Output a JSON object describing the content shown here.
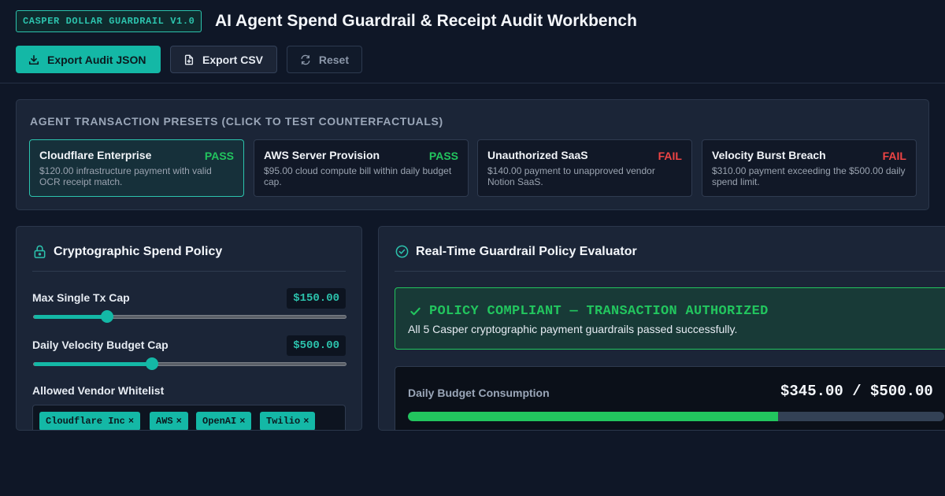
{
  "header": {
    "badge": "CASPER DOLLAR GUARDRAIL V1.0",
    "title": "AI Agent Spend Guardrail & Receipt Audit Workbench",
    "buttons": {
      "export_json": "Export Audit JSON",
      "export_csv": "Export CSV",
      "reset": "Reset"
    }
  },
  "presets": {
    "title": "AGENT TRANSACTION PRESETS (CLICK TO TEST COUNTERFACTUALS)",
    "items": [
      {
        "name": "Cloudflare Enterprise",
        "status": "PASS",
        "desc": "$120.00 infrastructure payment with valid OCR receipt match."
      },
      {
        "name": "AWS Server Provision",
        "status": "PASS",
        "desc": "$95.00 cloud compute bill within daily budget cap."
      },
      {
        "name": "Unauthorized SaaS",
        "status": "FAIL",
        "desc": "$140.00 payment to unapproved vendor Notion SaaS."
      },
      {
        "name": "Velocity Burst Breach",
        "status": "FAIL",
        "desc": "$310.00 payment exceeding the $500.00 daily spend limit."
      }
    ]
  },
  "policy": {
    "title": "Cryptographic Spend Policy",
    "max_tx": {
      "label": "Max Single Tx Cap",
      "value": "$150.00",
      "fraction": 0.235
    },
    "daily_cap": {
      "label": "Daily Velocity Budget Cap",
      "value": "$500.00",
      "fraction": 0.38
    },
    "vendors": {
      "label": "Allowed Vendor Whitelist",
      "tags": [
        "Cloudflare Inc",
        "AWS",
        "OpenAI",
        "Twilio"
      ],
      "remove_glyph": "×"
    }
  },
  "evaluator": {
    "title": "Real-Time Guardrail Policy Evaluator",
    "banner_title": "POLICY COMPLIANT — TRANSACTION AUTHORIZED",
    "banner_subtitle": "All 5 Casper cryptographic payment guardrails passed successfully.",
    "budget_label": "Daily Budget Consumption",
    "budget_value": "$345.00 / $500.00",
    "budget_fraction": 0.69
  },
  "colors": {
    "accent": "#14b8a6",
    "pass": "#22c55e",
    "fail": "#ef4444",
    "background": "#0f1727"
  },
  "icons": {
    "export_json": "download-icon",
    "export_csv": "file-plus-icon",
    "reset": "refresh-icon",
    "policy": "lock-icon",
    "evaluator": "check-circle-icon",
    "banner": "check-icon"
  }
}
